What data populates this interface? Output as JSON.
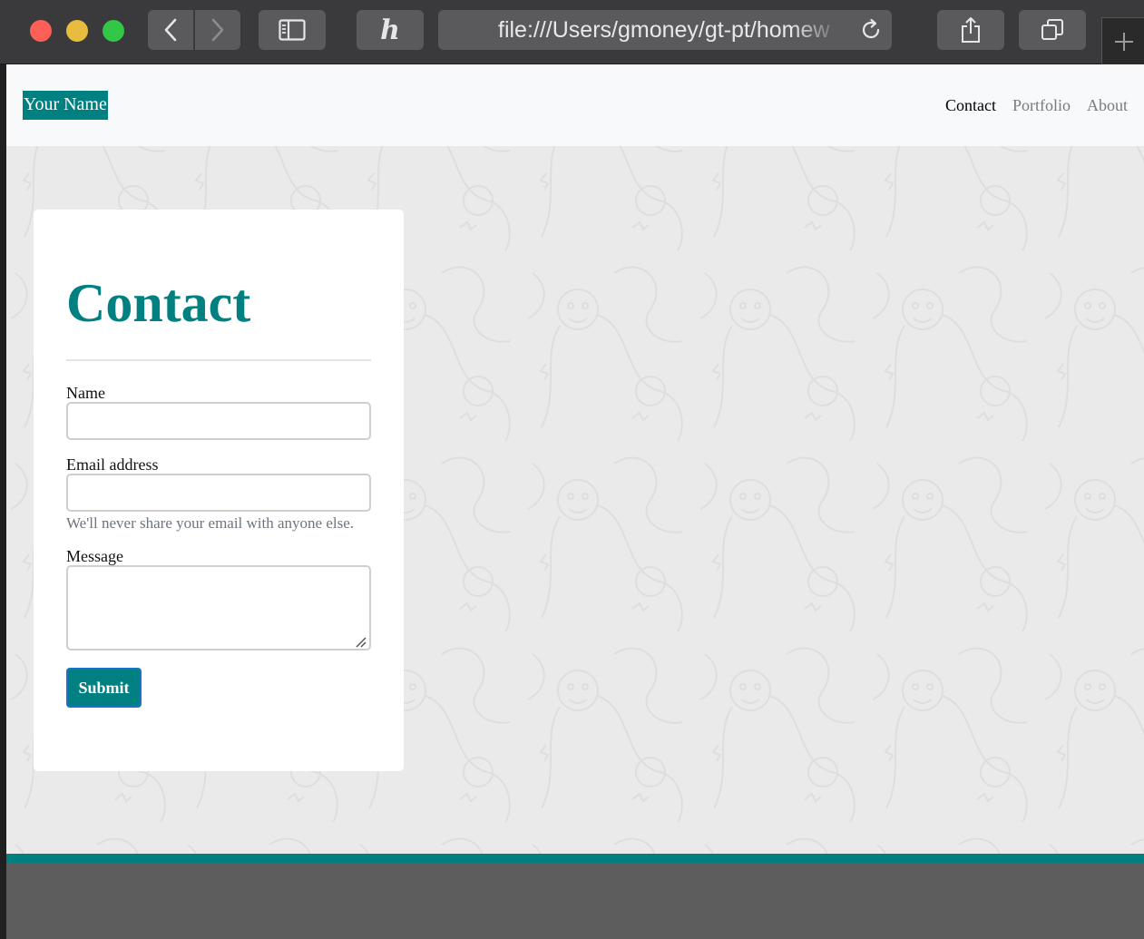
{
  "browser": {
    "url": "file:///Users/gmoney/gt-pt/homew",
    "icons": {
      "back": "chevron-left-icon",
      "forward": "chevron-right-icon",
      "sidebar": "sidebar-icon",
      "extension": "honey-h-icon",
      "reload": "reload-icon",
      "share": "share-icon",
      "tabs": "tabs-overview-icon",
      "new_tab": "plus-icon"
    }
  },
  "navbar": {
    "brand": "Your Name",
    "links": [
      "Contact",
      "Portfolio",
      "About"
    ],
    "active": "Contact"
  },
  "contact": {
    "heading": "Contact",
    "name_label": "Name",
    "email_label": "Email address",
    "email_help": "We'll never share your email with anyone else.",
    "message_label": "Message",
    "submit_label": "Submit"
  },
  "colors": {
    "accent": "#008080",
    "navbar_bg": "#f8f9fa",
    "page_bg": "#eaeaea",
    "help_text": "#6c757d",
    "submit_border": "#1a73c8"
  }
}
